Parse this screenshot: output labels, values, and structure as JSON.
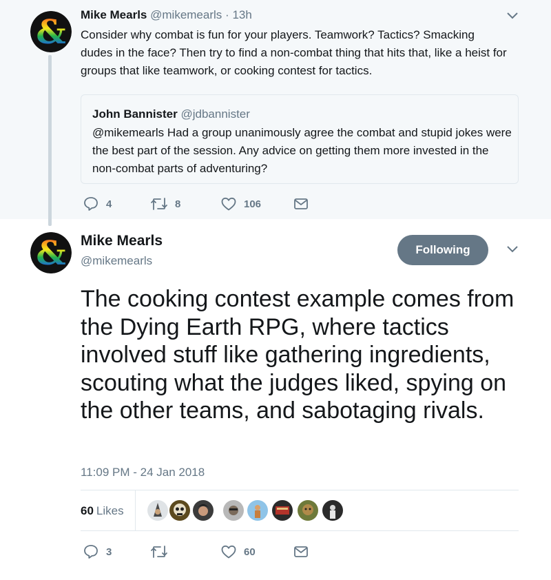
{
  "parent_tweet": {
    "author_name": "Mike Mearls",
    "author_handle": "@mikemearls",
    "separator": "·",
    "time": "13h",
    "text": "Consider why combat is fun for your players. Teamwork? Tactics? Smacking dudes in the face? Then try to find a non-combat thing that hits that, like a heist for groups that like teamwork, or cooking contest for tactics.",
    "quoted": {
      "author_name": "John Bannister",
      "author_handle": "@jdbannister",
      "text": "@mikemearls Had a group unanimously agree the combat and stupid jokes were the best part of the session. Any advice on getting them more invested in the non-combat parts of adventuring?"
    },
    "actions": {
      "replies": "4",
      "retweets": "8",
      "likes": "106"
    }
  },
  "main_tweet": {
    "author_name": "Mike Mearls",
    "author_handle": "@mikemearls",
    "follow_label": "Following",
    "text": "The cooking contest example comes from the Dying Earth RPG, where tactics involved stuff like gathering ingredients, scouting what the judges liked, spying on the other teams, and sabotaging rivals.",
    "timestamp": "11:09 PM - 24 Jan 2018",
    "like_count": "60",
    "like_label": "Likes",
    "actions": {
      "replies": "3",
      "retweets": "",
      "likes": "60"
    }
  },
  "icons": {
    "avatar": "dnd-ampersand-logo",
    "reply": "reply-icon",
    "retweet": "retweet-icon",
    "like": "heart-icon",
    "dm": "envelope-icon",
    "more": "chevron-down-icon"
  },
  "colors": {
    "muted": "#657786",
    "following_button": "#657786",
    "parent_background": "#f5f8fa",
    "border": "#e1e8ed"
  }
}
